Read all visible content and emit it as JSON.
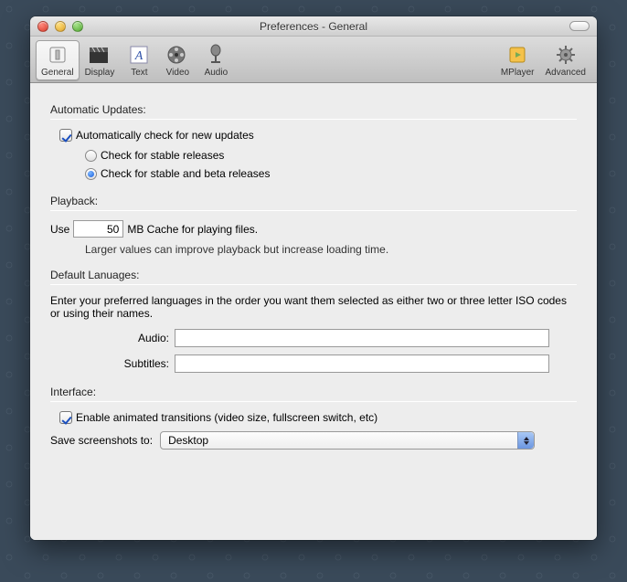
{
  "window": {
    "title": "Preferences - General"
  },
  "toolbar": {
    "general": "General",
    "display": "Display",
    "text": "Text",
    "video": "Video",
    "audio": "Audio",
    "mplayer": "MPlayer",
    "advanced": "Advanced"
  },
  "sections": {
    "updates": {
      "heading": "Automatic Updates:",
      "auto_check_label": "Automatically check for new updates",
      "stable_label": "Check for stable releases",
      "beta_label": "Check for stable and beta releases"
    },
    "playback": {
      "heading": "Playback:",
      "use_prefix": "Use",
      "cache_value": "50",
      "use_suffix": "MB Cache for playing files.",
      "help": "Larger values can improve playback but increase loading time."
    },
    "languages": {
      "heading": "Default Lanuages:",
      "description": "Enter your preferred languages in the order you want them selected as either two or three letter ISO codes or using their names.",
      "audio_label": "Audio:",
      "subtitles_label": "Subtitles:",
      "audio_value": "",
      "subtitles_value": ""
    },
    "interface": {
      "heading": "Interface:",
      "animated_label": "Enable animated transitions (video size, fullscreen switch, etc)",
      "screenshots_label": "Save screenshots to:",
      "screenshots_value": "Desktop"
    }
  }
}
